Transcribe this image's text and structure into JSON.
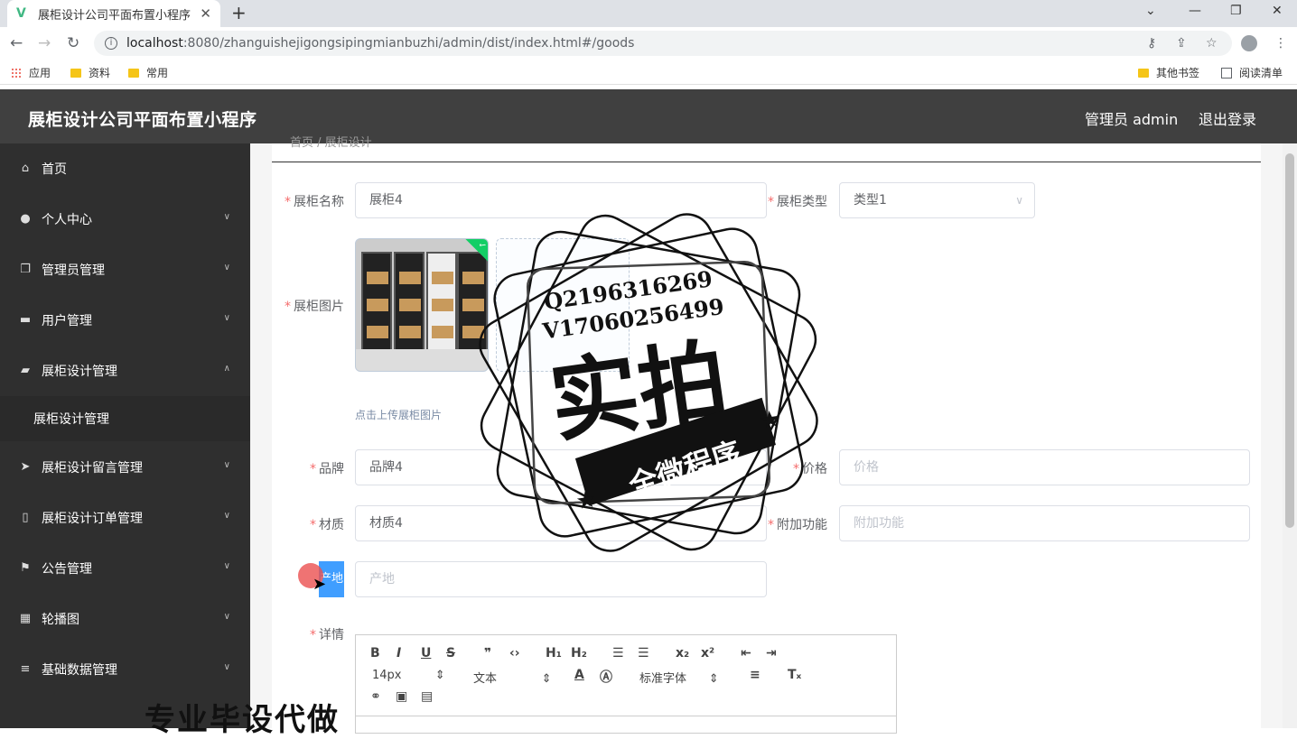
{
  "browser": {
    "tab_title": "展柜设计公司平面布置小程序",
    "url_host": "localhost",
    "url_path": ":8080/zhanguishejigongsipingmianbuzhi/admin/dist/index.html#/goods",
    "bookmarks": [
      "应用",
      "资料",
      "常用"
    ],
    "bookmarks_right": [
      "其他书签",
      "阅读清单"
    ]
  },
  "header": {
    "title": "展柜设计公司平面布置小程序",
    "admin_label": "管理员 admin",
    "logout": "退出登录"
  },
  "sidebar": {
    "items": [
      {
        "label": "首页",
        "icon": "home-icon"
      },
      {
        "label": "个人中心",
        "icon": "user-icon"
      },
      {
        "label": "管理员管理",
        "icon": "copy-icon"
      },
      {
        "label": "用户管理",
        "icon": "monitor-icon"
      },
      {
        "label": "展柜设计管理",
        "icon": "briefcase-icon"
      },
      {
        "label": "展柜设计留言管理",
        "icon": "send-icon"
      },
      {
        "label": "展柜设计订单管理",
        "icon": "phone-icon"
      },
      {
        "label": "公告管理",
        "icon": "flag-icon"
      },
      {
        "label": "轮播图",
        "icon": "grid-icon"
      },
      {
        "label": "基础数据管理",
        "icon": "menu-icon"
      }
    ],
    "submenu": "展柜设计管理"
  },
  "breadcrumb": "首页 / 展柜设计",
  "form": {
    "name_label": "展柜名称",
    "name_value": "展柜4",
    "type_label": "展柜类型",
    "type_value": "类型1",
    "image_label": "展柜图片",
    "upload_hint": "点击上传展柜图片",
    "brand_label": "品牌",
    "brand_value": "品牌4",
    "price_label": "价格",
    "price_placeholder": "价格",
    "material_label": "材质",
    "material_value": "材质4",
    "extra_label": "附加功能",
    "extra_placeholder": "附加功能",
    "origin_label": "产地",
    "origin_placeholder": "产地",
    "detail_label": "详情"
  },
  "editor": {
    "font_size": "14px",
    "block_type": "文本",
    "font_family": "标准字体"
  },
  "watermark": {
    "line1": "Q2196316269",
    "line2": "V17060256499",
    "big": "实拍",
    "banner": "全微程序",
    "bottom": "专业毕设代做"
  }
}
